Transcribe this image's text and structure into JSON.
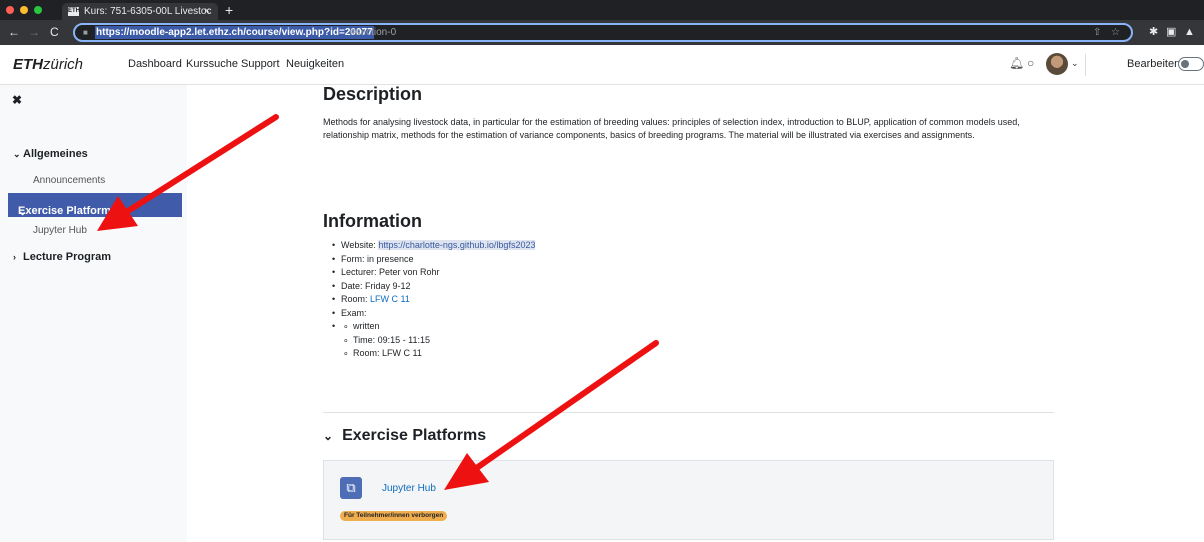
{
  "browser": {
    "tab_title": "Kurs: 751-6305-00L Livestoc",
    "tab_favicon": "ETH",
    "url_selected": "https://moodle-app2.let.ethz.ch/course/view.php?id=20077",
    "url_fragment": "#section-0"
  },
  "navbar": {
    "logo_bold": "ETH",
    "logo_rest": "zürich",
    "links": [
      "Dashboard",
      "Kurssuche",
      "Support",
      "Neuigkeiten"
    ],
    "edit_mode_label": "Bearbeiten"
  },
  "course_index": {
    "sections": [
      {
        "title": "Allgemeines",
        "items": [
          "Announcements"
        ]
      },
      {
        "title": "Exercise Platform",
        "items": [
          "Jupyter Hub"
        ]
      },
      {
        "title": "Lecture Program",
        "items": []
      }
    ]
  },
  "main": {
    "description_heading": "Description",
    "description_text": "Methods for analysing livestock data, in particular for the estimation of breeding values: principles of selection index, introduction to BLUP, application of common models used, relationship matrix, methods for the estimation of variance components, basics of breeding programs. The material will be illustrated via exercises and assignments.",
    "information_heading": "Information",
    "website_label": "Website: ",
    "website_link": "https://charlotte-ngs.github.io/lbgfs2023",
    "form": "Form: in presence",
    "lecturer": "Lecturer: Peter von Rohr",
    "date": "Date: Friday 9-12",
    "room_label": "Room: ",
    "room_link": "LFW C 11",
    "exam_label": "Exam:",
    "exam_items": [
      "written",
      "Time: 09:15 - 11:15",
      "Room: LFW C 11"
    ],
    "section_title": "Exercise Platforms",
    "activity_name": "Jupyter Hub",
    "activity_badge": "Für Teilnehmer/innen verborgen"
  },
  "colors": {
    "primary": "#0f6cbf",
    "drawer_active": "#3f5ba9",
    "badge": "#f0ad4e",
    "annotation_arrow": "#ee1111"
  }
}
